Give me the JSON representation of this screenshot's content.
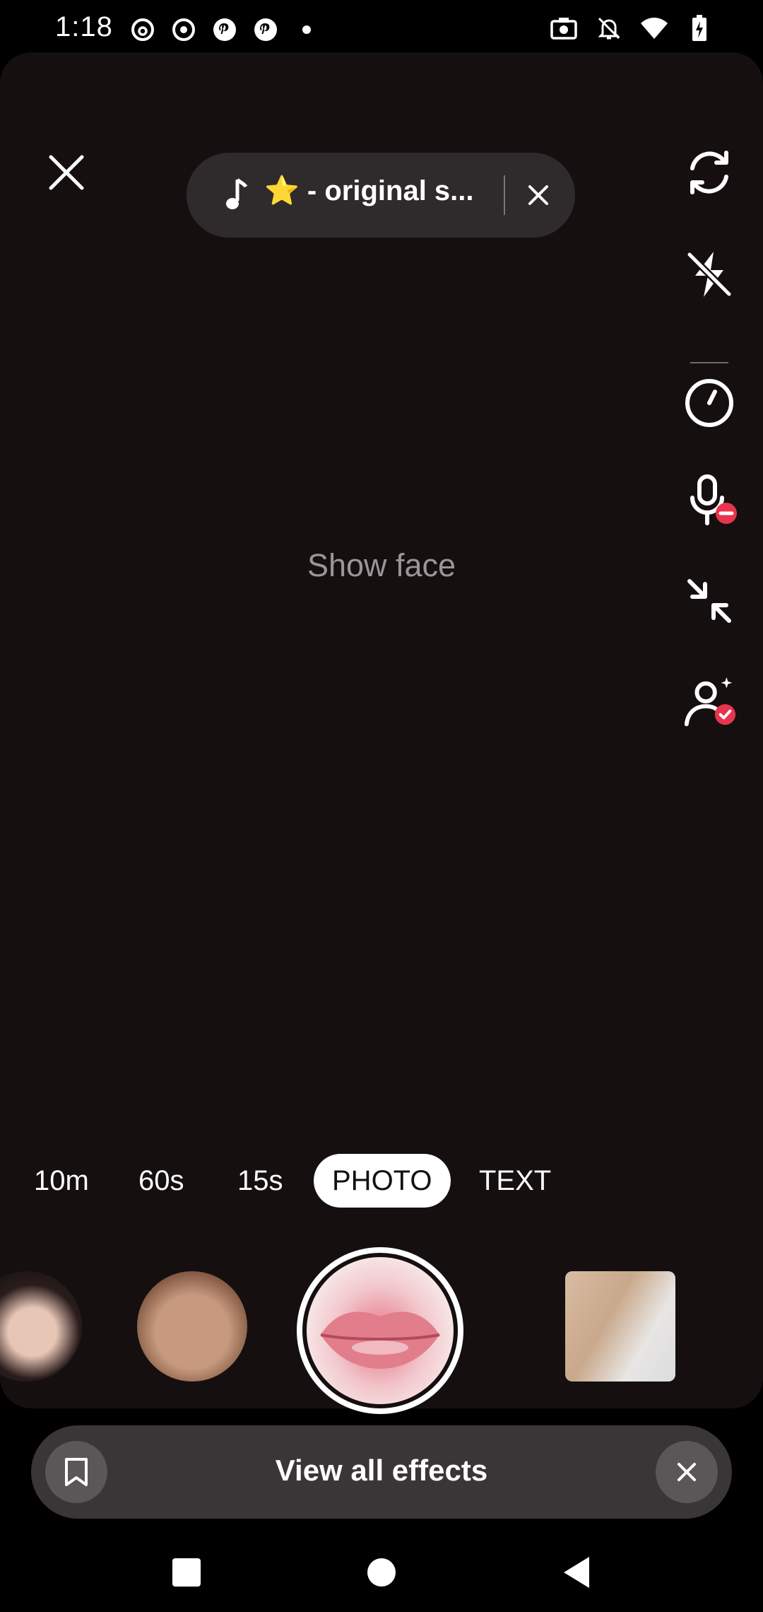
{
  "status_bar": {
    "time": "1:18",
    "left_icons": [
      "threads-icon",
      "target-icon",
      "pinterest-icon",
      "pinterest-icon",
      "dot-icon"
    ],
    "right_icons": [
      "camera-icon",
      "bell-off-icon",
      "wifi-icon",
      "battery-charging-icon"
    ]
  },
  "camera": {
    "music_title": "⭐️ - original s...",
    "placeholder": "Show face",
    "tools": [
      "flip-camera-icon",
      "flash-off-icon",
      "timer-icon",
      "mic-off-icon",
      "collapse-icon",
      "face-retouch-icon"
    ],
    "modes": [
      "10m",
      "60s",
      "15s",
      "PHOTO",
      "TEXT"
    ],
    "active_mode": "PHOTO"
  },
  "effects_bar": {
    "label": "View all effects"
  },
  "colors": {
    "badge_red": "#e8344e",
    "viewport_bg": "#150f10",
    "pill_bg": "#2f2a2b"
  }
}
